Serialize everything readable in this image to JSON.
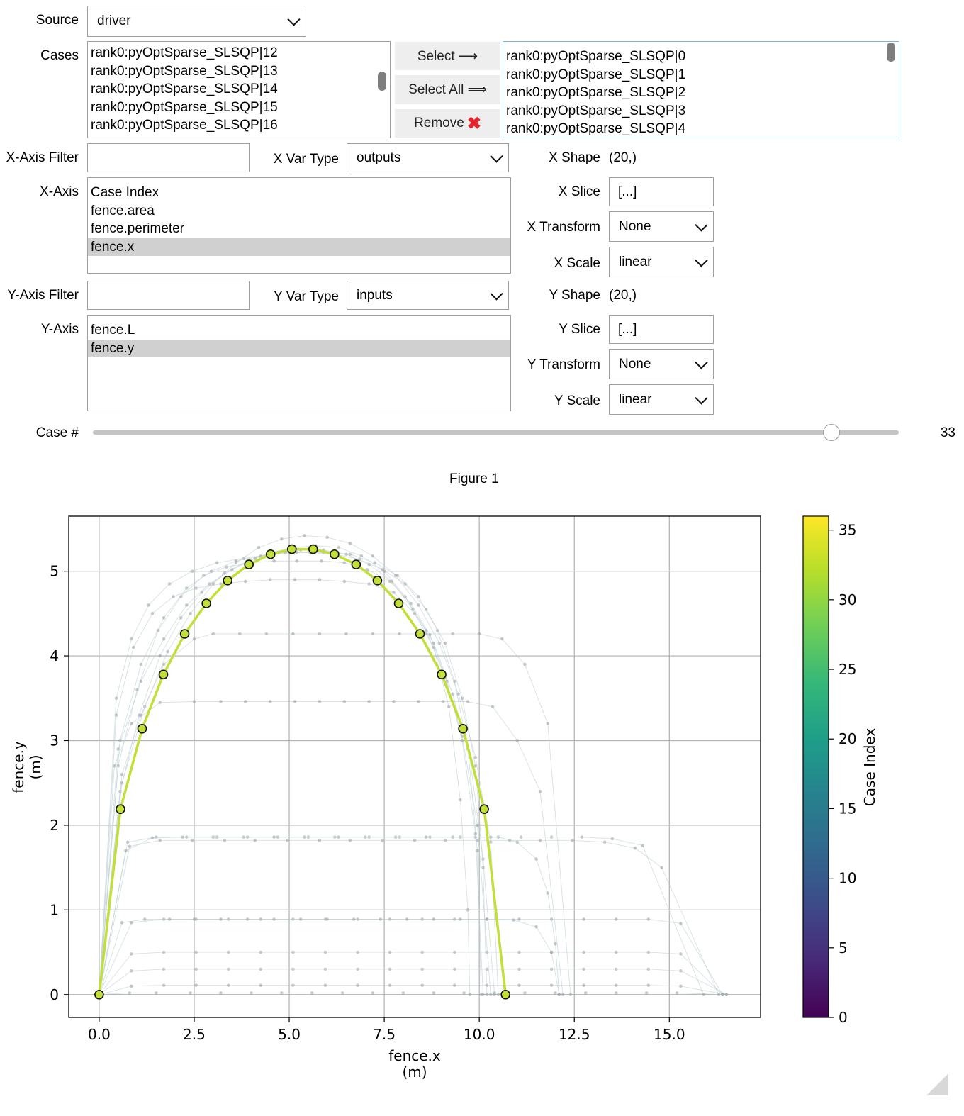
{
  "source": {
    "label": "Source",
    "value": "driver"
  },
  "cases": {
    "label": "Cases",
    "available": [
      "rank0:pyOptSparse_SLSQP|12",
      "rank0:pyOptSparse_SLSQP|13",
      "rank0:pyOptSparse_SLSQP|14",
      "rank0:pyOptSparse_SLSQP|15",
      "rank0:pyOptSparse_SLSQP|16"
    ],
    "selected": [
      "rank0:pyOptSparse_SLSQP|0",
      "rank0:pyOptSparse_SLSQP|1",
      "rank0:pyOptSparse_SLSQP|2",
      "rank0:pyOptSparse_SLSQP|3",
      "rank0:pyOptSparse_SLSQP|4"
    ],
    "select_btn": "Select ⟶",
    "select_all_btn": "Select All ⟹",
    "remove_btn": "Remove",
    "remove_glyph": "✖"
  },
  "x": {
    "filter_label": "X-Axis Filter",
    "filter_value": "",
    "var_type_label": "X Var Type",
    "var_type": "outputs",
    "axis_label": "X-Axis",
    "vars": [
      "Case Index",
      "fence.area",
      "fence.perimeter",
      "fence.x"
    ],
    "selected_var": "fence.x",
    "shape_label": "X Shape",
    "shape": "(20,)",
    "slice_label": "X Slice",
    "slice": "[...]",
    "transform_label": "X Transform",
    "transform": "None",
    "scale_label": "X Scale",
    "scale": "linear"
  },
  "y": {
    "filter_label": "Y-Axis Filter",
    "filter_value": "",
    "var_type_label": "Y Var Type",
    "var_type": "inputs",
    "axis_label": "Y-Axis",
    "vars": [
      "fence.L",
      "fence.y"
    ],
    "selected_var": "fence.y",
    "shape_label": "Y Shape",
    "shape": "(20,)",
    "slice_label": "Y Slice",
    "slice": "[...]",
    "transform_label": "Y Transform",
    "transform": "None",
    "scale_label": "Y Scale",
    "scale": "linear"
  },
  "case_slider": {
    "label": "Case #",
    "value": "33",
    "value_num": 33,
    "min": 0,
    "max": 36
  },
  "figure": {
    "title": "Figure 1"
  },
  "chart_data": {
    "type": "line",
    "xlabel": "fence.x",
    "xunit": "(m)",
    "ylabel": "fence.y",
    "yunit": "(m)",
    "xlim": [
      -0.8,
      17.4
    ],
    "ylim": [
      -0.27,
      5.65
    ],
    "xticks": [
      0.0,
      2.5,
      5.0,
      7.5,
      10.0,
      12.5,
      15.0
    ],
    "xtick_labels": [
      "0.0",
      "2.5",
      "5.0",
      "7.5",
      "10.0",
      "12.5",
      "15.0"
    ],
    "yticks": [
      0,
      1,
      2,
      3,
      4,
      5
    ],
    "ytick_labels": [
      "0",
      "1",
      "2",
      "3",
      "4",
      "5"
    ],
    "grid": true,
    "highlighted_case": {
      "color": "#c2df38",
      "x": [
        0.0,
        0.56,
        1.13,
        1.69,
        2.25,
        2.82,
        3.38,
        3.94,
        4.51,
        5.07,
        5.63,
        6.19,
        6.76,
        7.32,
        7.88,
        8.44,
        9.01,
        9.57,
        10.13,
        10.69
      ],
      "y": [
        0.0,
        2.19,
        3.14,
        3.78,
        4.26,
        4.62,
        4.89,
        5.08,
        5.2,
        5.26,
        5.26,
        5.2,
        5.08,
        4.89,
        4.62,
        4.26,
        3.78,
        3.14,
        2.19,
        0.0
      ]
    },
    "background_cases": [
      {
        "x": [
          0,
          0.8,
          1.5,
          2.4,
          3.2,
          4,
          4.8,
          5.6,
          6.4,
          7.2,
          8,
          8.8,
          9.6,
          10.4,
          11.2,
          12,
          12.8,
          13.6,
          14.4,
          15.2,
          16.4
        ],
        "y": [
          0,
          0.02,
          0.02,
          0.02,
          0.02,
          0.02,
          0.02,
          0.02,
          0.02,
          0.02,
          0.02,
          0.02,
          0.02,
          0.02,
          0.02,
          0.02,
          0.02,
          0.02,
          0.02,
          0.02,
          0
        ]
      },
      {
        "x": [
          0,
          0.85,
          1.7,
          2.55,
          3.4,
          4.25,
          5.1,
          5.95,
          6.8,
          7.65,
          8.5,
          9.35,
          10.2,
          11.05,
          11.9,
          12.75,
          13.6,
          14.45,
          15.3,
          16.5
        ],
        "y": [
          0,
          0.1,
          0.11,
          0.11,
          0.11,
          0.11,
          0.11,
          0.11,
          0.11,
          0.11,
          0.11,
          0.11,
          0.11,
          0.11,
          0.11,
          0.11,
          0.11,
          0.11,
          0.1,
          0
        ]
      },
      {
        "x": [
          0,
          0.85,
          1.7,
          2.55,
          3.4,
          4.25,
          5.1,
          5.95,
          6.8,
          7.65,
          8.5,
          9.35,
          10.2,
          11.05,
          11.9,
          12.75,
          13.6,
          14.45,
          15.3,
          16.5
        ],
        "y": [
          0,
          0.28,
          0.3,
          0.3,
          0.3,
          0.3,
          0.3,
          0.3,
          0.3,
          0.3,
          0.3,
          0.3,
          0.3,
          0.3,
          0.3,
          0.3,
          0.3,
          0.3,
          0.28,
          0
        ]
      },
      {
        "x": [
          0,
          0.85,
          1.7,
          2.55,
          3.4,
          4.25,
          5.1,
          5.95,
          6.8,
          7.65,
          8.5,
          9.35,
          10.2,
          11.05,
          11.9,
          12.75,
          13.6,
          14.45,
          15.3,
          16.4
        ],
        "y": [
          0,
          0.48,
          0.5,
          0.5,
          0.5,
          0.5,
          0.5,
          0.5,
          0.5,
          0.5,
          0.5,
          0.5,
          0.5,
          0.5,
          0.5,
          0.5,
          0.5,
          0.5,
          0.48,
          0
        ]
      },
      {
        "x": [
          0,
          0.85,
          1.7,
          2.55,
          3.4,
          4.25,
          5.1,
          5.95,
          6.8,
          7.65,
          8.5,
          9.35,
          10.2,
          11.05,
          11.9,
          12.75,
          13.6,
          14.45,
          15.3,
          16.4
        ],
        "y": [
          0,
          0.85,
          0.89,
          0.89,
          0.89,
          0.89,
          0.89,
          0.89,
          0.89,
          0.89,
          0.89,
          0.89,
          0.89,
          0.89,
          0.89,
          0.89,
          0.89,
          0.89,
          0.84,
          0
        ]
      },
      {
        "x": [
          0,
          0.8,
          1.6,
          2.45,
          3.3,
          4.1,
          4.95,
          5.8,
          6.6,
          7.45,
          8.3,
          9.1,
          9.95,
          10.8,
          11.6,
          12.45,
          13.3,
          14.1,
          14.8,
          16.3
        ],
        "y": [
          0,
          1.75,
          1.82,
          1.82,
          1.82,
          1.82,
          1.82,
          1.82,
          1.82,
          1.82,
          1.82,
          1.82,
          1.82,
          1.82,
          1.82,
          1.82,
          1.8,
          1.73,
          1.5,
          0
        ]
      },
      {
        "x": [
          0,
          0.75,
          1.5,
          2.3,
          3.1,
          3.9,
          4.7,
          5.5,
          6.3,
          7.1,
          7.9,
          8.7,
          9.5,
          10.3,
          11.1,
          11.9,
          12.7,
          13.5,
          14.3,
          15.9
        ],
        "y": [
          0,
          1.8,
          1.86,
          1.86,
          1.86,
          1.86,
          1.86,
          1.86,
          1.86,
          1.86,
          1.86,
          1.86,
          1.86,
          1.86,
          1.86,
          1.86,
          1.86,
          1.84,
          1.76,
          0
        ]
      },
      {
        "x": [
          0,
          0.4,
          0.85,
          1.6,
          2.5,
          3.2,
          3.85,
          4.5,
          5.15,
          5.8,
          6.45,
          7.1,
          7.75,
          8.4,
          9.05,
          9.7,
          10.35,
          11,
          11.6,
          12.2
        ],
        "y": [
          0,
          2.7,
          3.2,
          3.45,
          3.46,
          3.46,
          3.46,
          3.46,
          3.46,
          3.46,
          3.46,
          3.46,
          3.46,
          3.46,
          3.46,
          3.46,
          3.4,
          3.0,
          2.4,
          0
        ]
      },
      {
        "x": [
          0,
          0.6,
          1.1,
          1.7,
          2.5,
          3,
          3.7,
          4.4,
          5.1,
          5.8,
          6.5,
          7.2,
          7.9,
          8.6,
          9.3,
          10,
          10.6,
          11.2,
          11.8,
          12.4
        ],
        "y": [
          0,
          2.6,
          3.3,
          3.9,
          4.2,
          4.26,
          4.26,
          4.26,
          4.26,
          4.26,
          4.26,
          4.26,
          4.26,
          4.26,
          4.26,
          4.26,
          4.2,
          3.9,
          3.2,
          0
        ]
      },
      {
        "x": [
          0,
          0.45,
          0.9,
          1.4,
          1.95,
          2.55,
          3.2,
          3.85,
          4.5,
          5.15,
          5.8,
          6.45,
          7.1,
          7.75,
          8.3,
          8.8,
          9.2,
          9.5,
          9.7,
          9.75
        ],
        "y": [
          0,
          3.3,
          4.1,
          4.5,
          4.7,
          4.8,
          4.85,
          4.88,
          4.9,
          4.9,
          4.9,
          4.88,
          4.85,
          4.75,
          4.5,
          4.1,
          3.4,
          2.3,
          1.0,
          0
        ]
      },
      {
        "x": [
          0,
          0.5,
          1.0,
          1.55,
          2.15,
          2.75,
          3.35,
          4.0,
          4.6,
          5.2,
          5.85,
          6.45,
          7.05,
          7.65,
          8.2,
          8.7,
          9.15,
          9.55,
          9.9,
          10.1
        ],
        "y": [
          0,
          2.7,
          3.6,
          4.3,
          4.7,
          4.95,
          5.05,
          5.1,
          5.12,
          5.12,
          5.12,
          5.1,
          5.02,
          4.88,
          4.62,
          4.25,
          3.7,
          3.0,
          1.9,
          0
        ]
      },
      {
        "x": [
          0,
          0.45,
          0.85,
          1.3,
          1.85,
          2.45,
          3.1,
          3.8,
          4.5,
          5.2,
          5.9,
          6.6,
          7.25,
          7.85,
          8.4,
          8.9,
          9.35,
          9.7,
          9.95,
          10.05
        ],
        "y": [
          0,
          3.5,
          4.2,
          4.6,
          4.85,
          5.0,
          5.1,
          5.15,
          5.2,
          5.22,
          5.22,
          5.2,
          5.1,
          4.95,
          4.7,
          4.3,
          3.7,
          2.9,
          1.7,
          0
        ]
      },
      {
        "x": [
          0,
          0.55,
          1.05,
          1.6,
          2.15,
          2.7,
          3.3,
          3.9,
          4.5,
          5.1,
          5.7,
          6.3,
          6.9,
          7.5,
          8.05,
          8.6,
          9.1,
          9.55,
          9.95,
          10.3
        ],
        "y": [
          0,
          2.4,
          3.3,
          4.0,
          4.45,
          4.75,
          4.98,
          5.12,
          5.22,
          5.28,
          5.3,
          5.28,
          5.18,
          5.0,
          4.7,
          4.3,
          3.75,
          3.05,
          2.0,
          0
        ]
      },
      {
        "x": [
          0,
          0.6,
          1.2,
          1.8,
          2.4,
          3.0,
          3.6,
          4.2,
          4.8,
          5.4,
          6.0,
          6.6,
          7.2,
          7.8,
          8.4,
          8.95,
          9.45,
          9.9,
          10.3,
          10.5
        ],
        "y": [
          0,
          2.5,
          3.4,
          4.05,
          4.5,
          4.85,
          5.1,
          5.28,
          5.38,
          5.42,
          5.4,
          5.33,
          5.18,
          4.95,
          4.6,
          4.15,
          3.55,
          2.8,
          1.8,
          0
        ]
      },
      {
        "x": [
          0,
          0.5,
          1.1,
          1.7,
          2.3,
          2.9,
          3.5,
          4.1,
          4.7,
          5.3,
          5.9,
          6.5,
          7.1,
          7.7,
          8.25,
          8.8,
          9.3,
          9.75,
          10.1,
          10.4
        ],
        "y": [
          0,
          2.9,
          3.7,
          4.2,
          4.6,
          4.85,
          5.02,
          5.15,
          5.22,
          5.25,
          5.25,
          5.2,
          5.08,
          4.88,
          4.55,
          4.15,
          3.55,
          2.8,
          1.6,
          0
        ]
      },
      {
        "x": [
          0,
          0.55,
          1.1,
          1.7,
          2.3,
          2.95,
          3.6,
          4.25,
          4.9,
          5.55,
          6.2,
          6.85,
          7.45,
          8.05,
          8.6,
          9.1,
          9.55,
          9.9,
          10.1,
          10.2
        ],
        "y": [
          0,
          3.0,
          3.9,
          4.45,
          4.8,
          5.0,
          5.12,
          5.18,
          5.22,
          5.22,
          5.2,
          5.14,
          5.02,
          4.85,
          4.55,
          4.15,
          3.5,
          2.7,
          1.5,
          0
        ]
      },
      {
        "x": [
          0,
          0.7,
          1.4,
          2.2,
          3.0,
          3.8,
          4.6,
          5.4,
          6.2,
          7.0,
          7.8,
          8.6,
          9.3,
          9.9,
          10.5,
          11.0,
          11.5,
          11.8,
          12.0,
          12.1
        ],
        "y": [
          0,
          1.7,
          1.85,
          1.86,
          1.86,
          1.86,
          1.86,
          1.86,
          1.86,
          1.86,
          1.86,
          1.86,
          1.86,
          1.86,
          1.86,
          1.8,
          1.6,
          1.2,
          0.6,
          0
        ]
      },
      {
        "x": [
          0,
          0.6,
          1.2,
          1.85,
          2.5,
          3.2,
          3.9,
          4.6,
          5.3,
          6.0,
          6.7,
          7.4,
          8.1,
          8.8,
          9.5,
          10.2,
          10.9,
          11.5,
          11.9,
          12.1
        ],
        "y": [
          0,
          0.85,
          0.89,
          0.89,
          0.89,
          0.89,
          0.89,
          0.89,
          0.89,
          0.89,
          0.89,
          0.89,
          0.89,
          0.89,
          0.89,
          0.89,
          0.88,
          0.8,
          0.5,
          0
        ]
      }
    ]
  },
  "colorbar": {
    "label": "Case Index",
    "min": 0,
    "max": 36,
    "ticks": [
      0,
      5,
      10,
      15,
      20,
      25,
      30,
      35
    ],
    "tick_labels": [
      "0",
      "5",
      "10",
      "15",
      "20",
      "25",
      "30",
      "35"
    ],
    "colormap": "viridis",
    "stops": [
      "#440154",
      "#482878",
      "#3e4a89",
      "#31688e",
      "#26828e",
      "#1f9e89",
      "#35b779",
      "#6ece58",
      "#b5de2b",
      "#fde725"
    ]
  }
}
